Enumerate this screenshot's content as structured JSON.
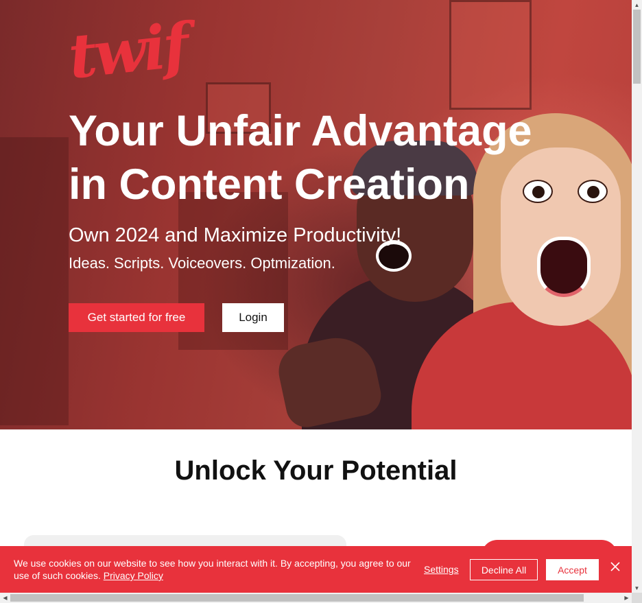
{
  "brand": {
    "logo_text": "twif",
    "accent_color": "#e8323c"
  },
  "hero": {
    "headline": "Your Unfair Advantage in Content Creation",
    "subheadline": "Own 2024 and Maximize Productivity!",
    "tagline": "Ideas. Scripts. Voiceovers. Optmization.",
    "cta_primary": "Get started for free",
    "cta_secondary": "Login"
  },
  "section": {
    "title": "Unlock Your Potential"
  },
  "cookie_banner": {
    "message": "We use cookies on our website to see how you interact with it. By accepting, you agree to our use of such cookies.",
    "policy_link": "Privacy Policy",
    "settings": "Settings",
    "decline": "Decline All",
    "accept": "Accept",
    "close_icon": "close-icon"
  },
  "scrollbars": {
    "up": "▲",
    "down": "▼",
    "left": "◀",
    "right": "▶"
  }
}
